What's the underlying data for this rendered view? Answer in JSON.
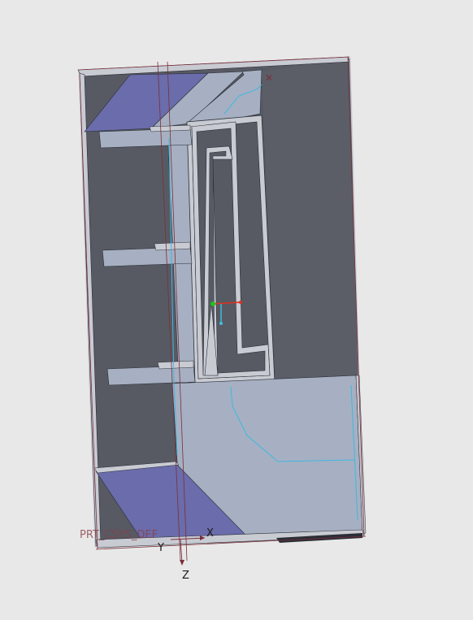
{
  "viewport": {
    "background": "#e8e8e8"
  },
  "model": {
    "colors": {
      "outline": "#c9cbd3",
      "dark_face": "#575a63",
      "light_face": "#a6b0c2",
      "purple_face": "#6a6cab",
      "edge": "#2b2e36",
      "construction_line": "#7a2f3a",
      "cyan_edge": "#3fb8e0"
    }
  },
  "csys": {
    "plane_label": "PRT_CSYS_DEF",
    "x_label": "X",
    "y_label": "Y",
    "z_label": "Z",
    "marker_x_color": "#e03020",
    "marker_y_color": "#20c020",
    "marker_z_color": "#40c0e0"
  }
}
